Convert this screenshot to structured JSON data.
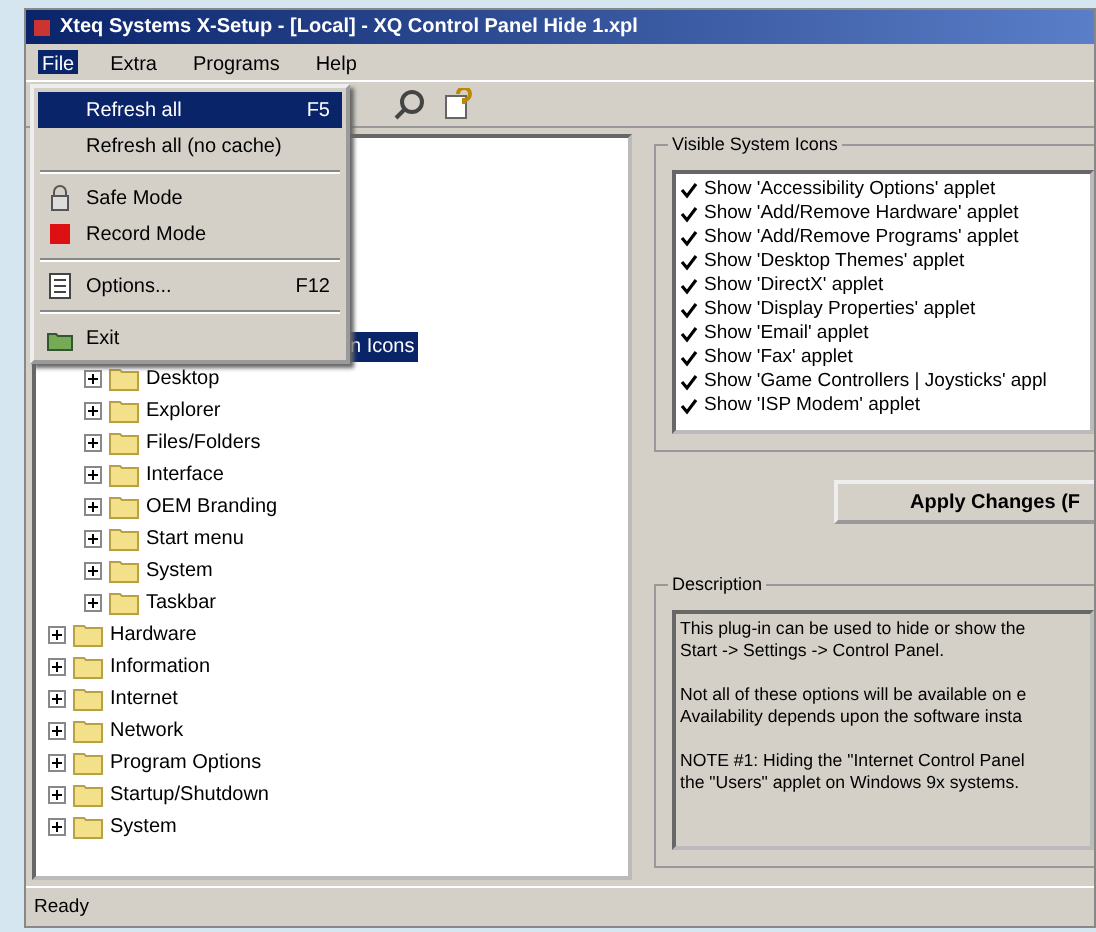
{
  "window": {
    "title": "Xteq Systems X-Setup - [Local] - XQ Control Panel Hide 1.xpl"
  },
  "menubar": [
    {
      "label": "File",
      "selected": true
    },
    {
      "label": "Extra",
      "selected": false
    },
    {
      "label": "Programs",
      "selected": false
    },
    {
      "label": "Help",
      "selected": false
    }
  ],
  "file_menu": [
    {
      "kind": "item",
      "label": "Refresh all",
      "shortcut": "F5",
      "selected": true
    },
    {
      "kind": "item",
      "label": "Refresh all (no cache)",
      "selected": false
    },
    {
      "kind": "separator"
    },
    {
      "kind": "lock",
      "label": "Safe Mode",
      "selected": false
    },
    {
      "kind": "record",
      "label": "Record Mode",
      "selected": false
    },
    {
      "kind": "separator"
    },
    {
      "kind": "options",
      "label": "Options...",
      "shortcut": "F12",
      "selected": false
    },
    {
      "kind": "separator"
    },
    {
      "kind": "exit",
      "label": "Exit",
      "selected": false
    }
  ],
  "tree": {
    "highlighted_node": "n Icons",
    "subitems": [
      {
        "label": "Desktop"
      },
      {
        "label": "Explorer"
      },
      {
        "label": "Files/Folders"
      },
      {
        "label": "Interface"
      },
      {
        "label": "OEM Branding"
      },
      {
        "label": "Start menu"
      },
      {
        "label": "System"
      },
      {
        "label": "Taskbar"
      }
    ],
    "items": [
      {
        "label": "Hardware"
      },
      {
        "label": "Information"
      },
      {
        "label": "Internet"
      },
      {
        "label": "Network"
      },
      {
        "label": "Program Options"
      },
      {
        "label": "Startup/Shutdown"
      },
      {
        "label": "System"
      }
    ]
  },
  "visible_icons": {
    "title": "Visible System Icons",
    "items": [
      {
        "label": "Show 'Accessibility Options' applet",
        "checked": true
      },
      {
        "label": "Show 'Add/Remove Hardware' applet",
        "checked": true
      },
      {
        "label": "Show 'Add/Remove Programs' applet",
        "checked": true
      },
      {
        "label": "Show 'Desktop Themes' applet",
        "checked": true
      },
      {
        "label": "Show 'DirectX' applet",
        "checked": true
      },
      {
        "label": "Show 'Display Properties' applet",
        "checked": true
      },
      {
        "label": "Show 'Email' applet",
        "checked": true
      },
      {
        "label": "Show 'Fax' applet",
        "checked": true
      },
      {
        "label": "Show 'Game Controllers | Joysticks' appl",
        "checked": true
      },
      {
        "label": "Show 'ISP Modem' applet",
        "checked": true
      }
    ]
  },
  "apply_button": "Apply Changes (F",
  "description": {
    "title": "Description",
    "paragraphs": [
      [
        "This plug-in can be used to hide or show the",
        "Start -> Settings -> Control Panel."
      ],
      [
        "Not all of these options will be available on e",
        "Availability depends upon the software insta"
      ],
      [
        "NOTE #1: Hiding the \"Internet Control Panel",
        "the \"Users\" applet on Windows 9x systems."
      ]
    ]
  },
  "status_bar": "Ready"
}
